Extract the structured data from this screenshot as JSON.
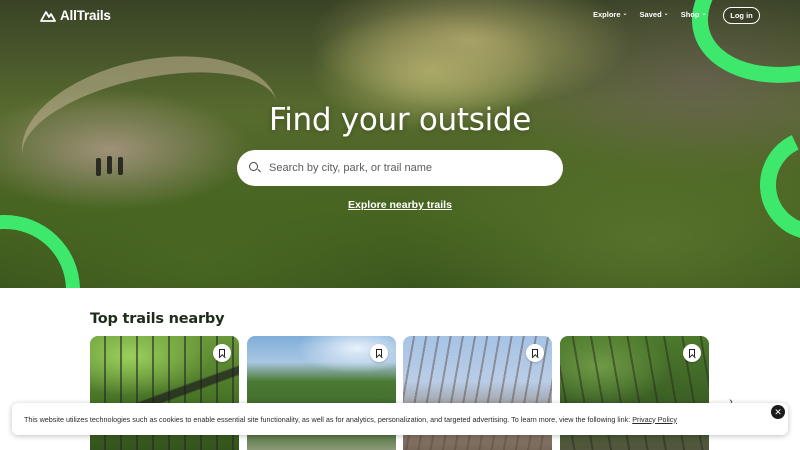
{
  "nav": {
    "logo_text": "AllTrails",
    "links": [
      {
        "label": "Explore",
        "icon": "chevron-down-icon"
      },
      {
        "label": "Saved",
        "icon": "chevron-down-icon"
      },
      {
        "label": "Shop",
        "icon": "chevron-down-icon"
      }
    ],
    "login_label": "Log in"
  },
  "hero": {
    "title": "Find your outside",
    "search_placeholder": "Search by city, park, or trail name",
    "search_icon": "search-icon",
    "explore_link": "Explore nearby trails"
  },
  "section": {
    "title": "Top trails nearby",
    "cards": [
      {
        "image": "trail-photo-bridge",
        "bookmark_icon": "bookmark-icon"
      },
      {
        "image": "trail-photo-river",
        "bookmark_icon": "bookmark-icon"
      },
      {
        "image": "trail-photo-bare-trees",
        "bookmark_icon": "bookmark-icon"
      },
      {
        "image": "trail-photo-forest-creek",
        "bookmark_icon": "bookmark-icon"
      }
    ],
    "next_icon": "chevron-right-icon"
  },
  "cookie_banner": {
    "text": "This website utilizes technologies such as cookies to enable essential site functionality, as well as for analytics, personalization, and targeted advertising. To learn more, view the following link: ",
    "link_text": "Privacy Policy",
    "close_icon": "close-icon"
  },
  "colors": {
    "accent_green": "#3ee86d",
    "text_dark": "#1f2b1a"
  }
}
